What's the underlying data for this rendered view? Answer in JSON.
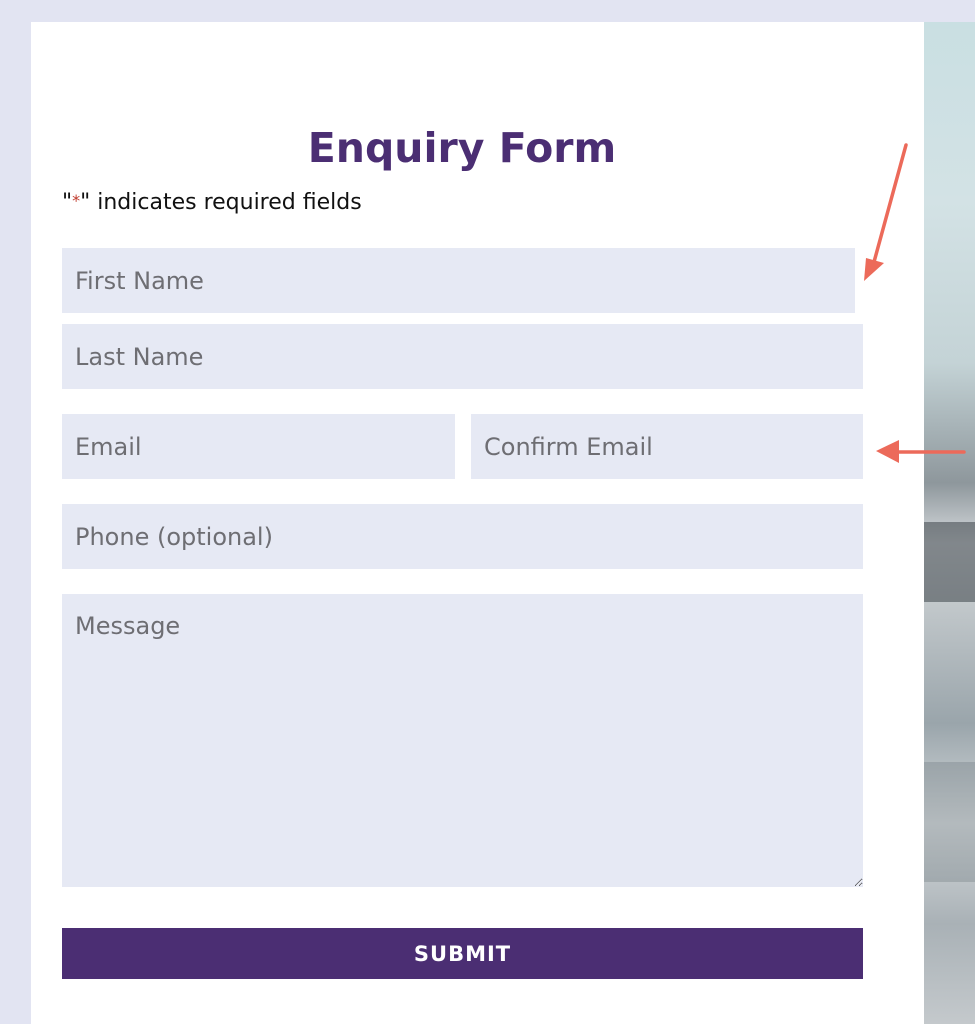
{
  "form": {
    "title": "Enquiry Form",
    "required_note": {
      "quote_open": "\"",
      "asterisk": "*",
      "quote_close": "\"",
      "text": " indicates required fields"
    },
    "fields": {
      "first_name": {
        "placeholder": "First Name",
        "value": ""
      },
      "last_name": {
        "placeholder": "Last Name",
        "value": ""
      },
      "email": {
        "placeholder": "Email",
        "value": ""
      },
      "confirm_email": {
        "placeholder": "Confirm Email",
        "value": ""
      },
      "phone": {
        "placeholder": "Phone (optional)",
        "value": ""
      },
      "message": {
        "placeholder": "Message",
        "value": ""
      }
    },
    "submit_label": "SUBMIT"
  },
  "annotations": {
    "arrow_color": "#ec6a5a",
    "arrows": [
      "arrow-pointing-first-name",
      "arrow-pointing-confirm-email"
    ]
  },
  "colors": {
    "page_background": "#e2e4f2",
    "card_background": "#ffffff",
    "title": "#4b2e73",
    "field_background": "#e6e9f4",
    "button_background": "#4b2e73",
    "button_text": "#ffffff",
    "required_asterisk": "#c0392b"
  }
}
